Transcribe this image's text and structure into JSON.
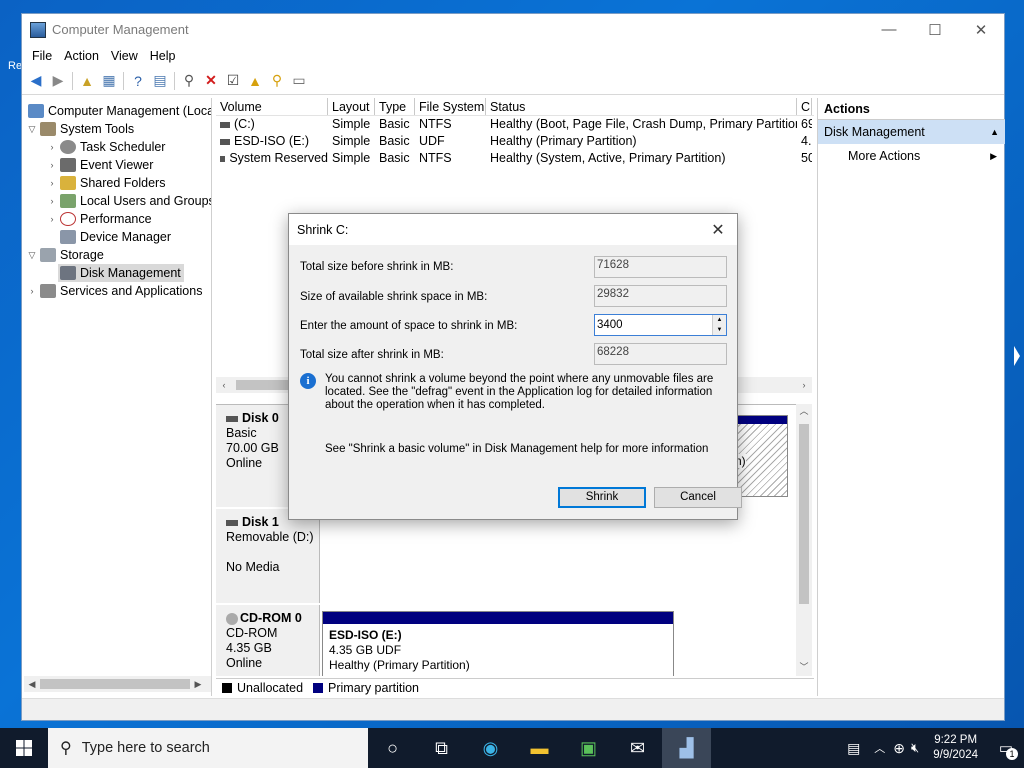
{
  "window": {
    "title": "Computer Management",
    "controls": {
      "minimize": "—",
      "maximize": "☐",
      "close": "✕"
    }
  },
  "menu": [
    "File",
    "Action",
    "View",
    "Help"
  ],
  "tree": {
    "root": "Computer Management (Local",
    "system_tools": "System Tools",
    "task_scheduler": "Task Scheduler",
    "event_viewer": "Event Viewer",
    "shared_folders": "Shared Folders",
    "local_users": "Local Users and Groups",
    "performance": "Performance",
    "device_manager": "Device Manager",
    "storage": "Storage",
    "disk_management": "Disk Management",
    "services": "Services and Applications"
  },
  "volumes": {
    "headers": [
      "Volume",
      "Layout",
      "Type",
      "File System",
      "Status",
      "C"
    ],
    "rows": [
      {
        "volume": "(C:)",
        "layout": "Simple",
        "type": "Basic",
        "fs": "NTFS",
        "status": "Healthy (Boot, Page File, Crash Dump, Primary Partition)",
        "cap": "69"
      },
      {
        "volume": "ESD-ISO (E:)",
        "layout": "Simple",
        "type": "Basic",
        "fs": "UDF",
        "status": "Healthy (Primary Partition)",
        "cap": "4."
      },
      {
        "volume": "System Reserved",
        "layout": "Simple",
        "type": "Basic",
        "fs": "NTFS",
        "status": "Healthy (System, Active, Primary Partition)",
        "cap": "50"
      }
    ]
  },
  "disks": {
    "disk0": {
      "name": "Disk 0",
      "type": "Basic",
      "size": "70.00 GB",
      "state": "Online",
      "partial": "n)"
    },
    "disk1": {
      "name": "Disk 1",
      "type": "Removable (D:)",
      "state": "No Media"
    },
    "cdrom0": {
      "name": "CD-ROM 0",
      "type": "CD-ROM",
      "size": "4.35 GB",
      "state": "Online",
      "part_name": "ESD-ISO  (E:)",
      "part_size": "4.35 GB UDF",
      "part_status": "Healthy (Primary Partition)"
    }
  },
  "legend": {
    "unallocated": "Unallocated",
    "primary": "Primary partition"
  },
  "actions": {
    "header": "Actions",
    "section": "Disk Management",
    "more": "More Actions"
  },
  "dialog": {
    "title": "Shrink C:",
    "total_before_label": "Total size before shrink in MB:",
    "total_before": "71628",
    "available_label": "Size of available shrink space in MB:",
    "available": "29832",
    "amount_label": "Enter the amount of space to shrink in MB:",
    "amount": "3400",
    "total_after_label": "Total size after shrink in MB:",
    "total_after": "68228",
    "info": "You cannot shrink a volume beyond the point where any unmovable files are located. See the \"defrag\" event in the Application log for detailed information about the operation when it has completed.",
    "help": "See \"Shrink a basic volume\" in Disk Management help for more information",
    "shrink": "Shrink",
    "cancel": "Cancel"
  },
  "taskbar": {
    "search_placeholder": "Type here to search",
    "time": "9:22 PM",
    "date": "9/9/2024",
    "notification_count": "1"
  },
  "colors": {
    "primary_partition": "#00007f",
    "unallocated": "#000000",
    "accent": "#0078d7"
  }
}
